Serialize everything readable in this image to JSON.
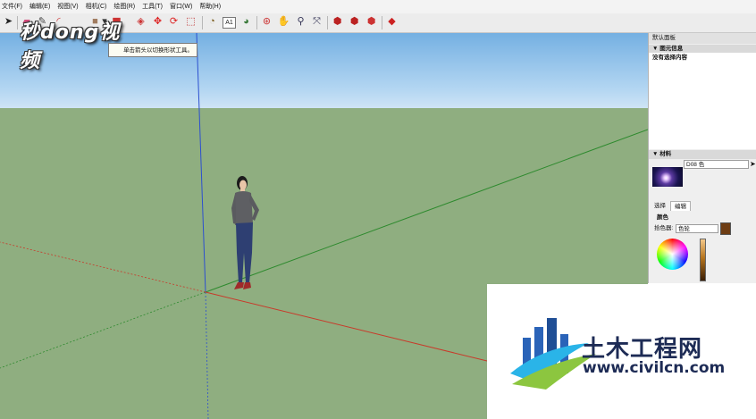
{
  "menu": {
    "items": [
      "文件(F)",
      "编辑(E)",
      "视图(V)",
      "相机(C)",
      "绘图(R)",
      "工具(T)",
      "窗口(W)",
      "帮助(H)"
    ]
  },
  "toolbar": {
    "tools": [
      {
        "icon": "select-arrow-icon",
        "glyph": "➤"
      },
      {
        "icon": "eraser-icon",
        "glyph": "▰"
      },
      {
        "icon": "line-pencil-icon",
        "glyph": "✎"
      },
      {
        "icon": "arc-icon",
        "glyph": "◜"
      },
      {
        "icon": "shapes-icon",
        "glyph": "■"
      },
      {
        "icon": "dropdown-arrow-icon",
        "glyph": "▾"
      },
      {
        "icon": "push-pull-icon",
        "glyph": "⬒"
      },
      {
        "icon": "offset-icon",
        "glyph": "◈"
      },
      {
        "icon": "move-icon",
        "glyph": "✥"
      },
      {
        "icon": "rotate-icon",
        "glyph": "⟳"
      },
      {
        "icon": "scale-icon",
        "glyph": "⬚"
      },
      {
        "icon": "tape-measure-icon",
        "glyph": "◔"
      },
      {
        "icon": "text-icon",
        "glyph": "A1"
      },
      {
        "icon": "paint-bucket-icon",
        "glyph": "◕"
      },
      {
        "icon": "orbit-icon",
        "glyph": "⊛"
      },
      {
        "icon": "pan-icon",
        "glyph": "✋"
      },
      {
        "icon": "zoom-icon",
        "glyph": "⚲"
      },
      {
        "icon": "zoom-extents-icon",
        "glyph": "⤧"
      },
      {
        "icon": "3d-warehouse-icon",
        "glyph": "⬢"
      },
      {
        "icon": "extension-warehouse-icon",
        "glyph": "⬢"
      },
      {
        "icon": "share-model-icon",
        "glyph": "⬢"
      },
      {
        "icon": "ruby-extension-icon",
        "glyph": "◆"
      }
    ]
  },
  "watermark_top": {
    "text": "秒dong视频"
  },
  "tooltip": {
    "text": "单击箭头以切换形状工具。"
  },
  "panel": {
    "title": "默认面板",
    "entity_info": {
      "header": "▼ 图元信息",
      "body": "没有选择内容"
    },
    "materials": {
      "header": "▼ 材料",
      "material_name": "D08 色",
      "tabs": [
        "选择",
        "编辑"
      ],
      "color_label": "颜色",
      "picker_label": "拾色器:",
      "picker_value": "色轮"
    }
  },
  "logo": {
    "title": "土木工程网",
    "url": "www.civilcn.com"
  },
  "colors": {
    "sky": "#74b0e2",
    "ground": "#8fae80",
    "axis_red": "#c83a2a",
    "axis_green": "#2e8a2e",
    "axis_blue": "#2c4fcf",
    "logo_navy": "#1d2b55",
    "swatch_brown": "#6e3d14"
  }
}
